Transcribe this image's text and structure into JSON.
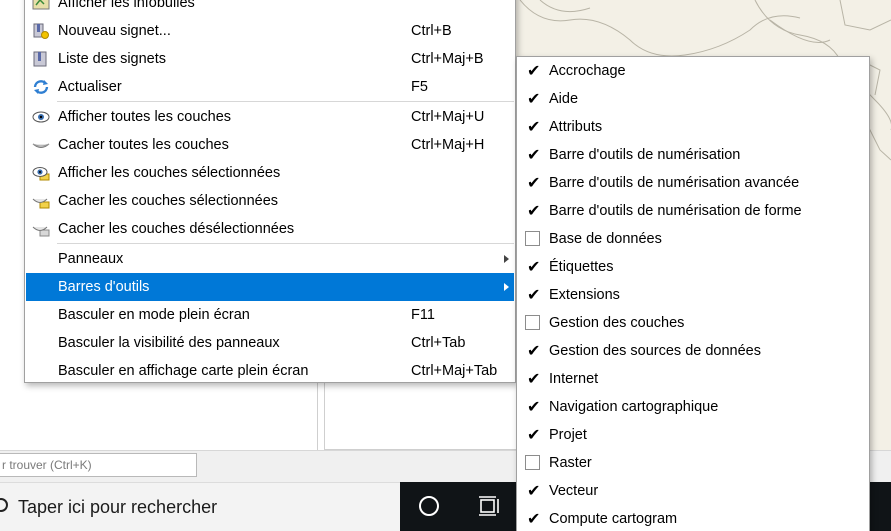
{
  "locator": {
    "placeholder": "r trouver (Ctrl+K)"
  },
  "taskbar": {
    "search_placeholder": "Taper ici pour rechercher"
  },
  "main_menu": {
    "items": [
      {
        "label": "Afficher les infobulles",
        "shortcut": "",
        "icon": "tooltip-icon"
      },
      {
        "label": "Nouveau signet...",
        "shortcut": "Ctrl+B",
        "icon": "new-bookmark-icon"
      },
      {
        "label": "Liste des signets",
        "shortcut": "Ctrl+Maj+B",
        "icon": "bookmarks-list-icon"
      },
      {
        "label": "Actualiser",
        "shortcut": "F5",
        "icon": "refresh-icon"
      },
      {
        "label": "Afficher toutes les couches",
        "shortcut": "Ctrl+Maj+U",
        "icon": "show-layers-icon"
      },
      {
        "label": "Cacher toutes les couches",
        "shortcut": "Ctrl+Maj+H",
        "icon": "hide-layers-icon"
      },
      {
        "label": "Afficher les couches sélectionnées",
        "shortcut": "",
        "icon": "show-selected-layers-icon"
      },
      {
        "label": "Cacher les couches sélectionnées",
        "shortcut": "",
        "icon": "hide-selected-layers-icon"
      },
      {
        "label": "Cacher les couches désélectionnées",
        "shortcut": "",
        "icon": "hide-deselected-layers-icon"
      },
      {
        "label": "Panneaux",
        "shortcut": "",
        "submenu": true
      },
      {
        "label": "Barres d'outils",
        "shortcut": "",
        "submenu": true,
        "highlighted": true
      },
      {
        "label": "Basculer en mode plein écran",
        "shortcut": "F11"
      },
      {
        "label": "Basculer la visibilité des panneaux",
        "shortcut": "Ctrl+Tab"
      },
      {
        "label": "Basculer en affichage carte plein écran",
        "shortcut": "Ctrl+Maj+Tab"
      }
    ]
  },
  "toolbars_submenu": {
    "items": [
      {
        "label": "Accrochage",
        "checked": true
      },
      {
        "label": "Aide",
        "checked": true
      },
      {
        "label": "Attributs",
        "checked": true
      },
      {
        "label": "Barre d'outils de numérisation",
        "checked": true
      },
      {
        "label": "Barre d'outils de numérisation avancée",
        "checked": true
      },
      {
        "label": "Barre d'outils de numérisation de forme",
        "checked": true
      },
      {
        "label": "Base de données",
        "checked": false
      },
      {
        "label": "Étiquettes",
        "checked": true
      },
      {
        "label": "Extensions",
        "checked": true
      },
      {
        "label": "Gestion des couches",
        "checked": false
      },
      {
        "label": "Gestion des sources de données",
        "checked": true
      },
      {
        "label": "Internet",
        "checked": true
      },
      {
        "label": "Navigation cartographique",
        "checked": true
      },
      {
        "label": "Projet",
        "checked": true
      },
      {
        "label": "Raster",
        "checked": false
      },
      {
        "label": "Vecteur",
        "checked": true
      },
      {
        "label": "Compute cartogram",
        "checked": true
      }
    ]
  },
  "colors": {
    "highlight": "#0078d7",
    "map_land": "#f3f0e6",
    "taskbar": "#101417"
  }
}
